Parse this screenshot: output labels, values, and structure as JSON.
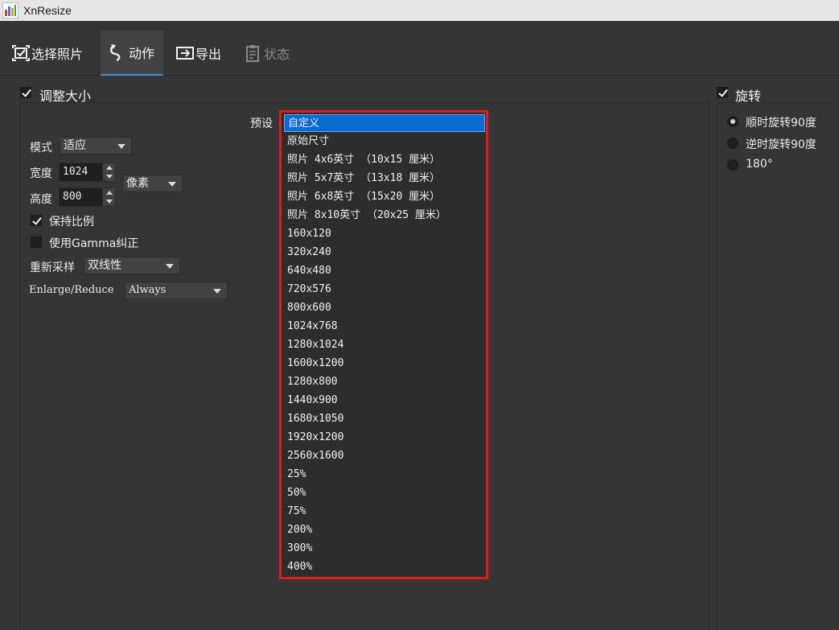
{
  "window": {
    "title": "XnResize"
  },
  "toolbar": {
    "tabs": [
      {
        "label": "选择照片",
        "icon": "select-photos-icon"
      },
      {
        "label": "动作",
        "icon": "action-icon"
      },
      {
        "label": "导出",
        "icon": "export-icon"
      },
      {
        "label": "状态",
        "icon": "status-icon"
      }
    ]
  },
  "resize": {
    "section_label": "调整大小",
    "preset_label": "预设",
    "mode_label": "模式",
    "mode_value": "适应",
    "width_label": "宽度",
    "width_value": "1024",
    "height_label": "高度",
    "height_value": "800",
    "unit_value": "像素",
    "keep_ratio_label": "保持比例",
    "gamma_label": "使用Gamma纠正",
    "resample_label": "重新采样",
    "resample_value": "双线性",
    "enlarge_label": "Enlarge/Reduce",
    "enlarge_value": "Always"
  },
  "preset_options": [
    "自定义",
    "原始尺寸",
    "照片  4x6英寸 （10x15 厘米）",
    "照片  5x7英寸 （13x18 厘米）",
    "照片  6x8英寸 （15x20 厘米）",
    "照片  8x10英寸 （20x25 厘米）",
    "160x120",
    "320x240",
    "640x480",
    "720x576",
    "800x600",
    "1024x768",
    "1280x1024",
    "1600x1200",
    "1280x800",
    "1440x900",
    "1680x1050",
    "1920x1200",
    "2560x1600",
    "25%",
    "50%",
    "75%",
    "200%",
    "300%",
    "400%"
  ],
  "rotate": {
    "section_label": "旋转",
    "options": [
      "顺时旋转90度",
      "逆时旋转90度",
      "180°"
    ]
  },
  "colors": {
    "background": "#353535",
    "selection": "#0a6bd0",
    "highlight_border": "#e21b1b",
    "tab_accent": "#3f8fd4"
  }
}
